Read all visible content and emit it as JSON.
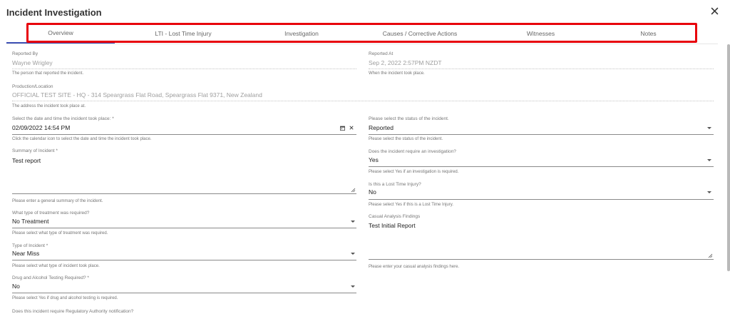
{
  "dialog": {
    "title": "Incident Investigation"
  },
  "tabs": [
    {
      "label": "Overview"
    },
    {
      "label": "LTI - Lost Time Injury"
    },
    {
      "label": "Investigation"
    },
    {
      "label": "Causes / Corrective Actions"
    },
    {
      "label": "Witnesses"
    },
    {
      "label": "Notes"
    }
  ],
  "form": {
    "reported_by": {
      "label": "Reported By",
      "value": "Wayne Wrigley",
      "hint": "The person that reported the incident."
    },
    "reported_at": {
      "label": "Reported At",
      "value": "Sep 2, 2022 2:57PM NZDT",
      "hint": "When the incident took place."
    },
    "production_location": {
      "label": "Production/Location",
      "value": "OFFICIAL TEST SITE - HQ - 314 Speargrass Flat Road, Speargrass Flat 9371, New Zealand",
      "hint": "The address the incident took place at."
    },
    "incident_datetime": {
      "label": "Select the date and time the incident took place: *",
      "value": "02/09/2022 14:54 PM",
      "hint": "Click the calendar icon to select the date and time the incident took place."
    },
    "status": {
      "label": "Please select the status of the incident.",
      "value": "Reported",
      "hint": "Please select the status of the incident."
    },
    "summary": {
      "label": "Summary of Incident *",
      "value": "Test report",
      "hint": "Please enter a general summary of the incident."
    },
    "requires_investigation": {
      "label": "Does the incident require an investigation?",
      "value": "Yes",
      "hint": "Please select Yes if an investigation is required."
    },
    "lost_time_injury": {
      "label": "Is this a Lost Time Injury?",
      "value": "No",
      "hint": "Please select Yes if this is a Lost Time Injury."
    },
    "treatment": {
      "label": "What type of treatment was required?",
      "value": "No Treatment",
      "hint": "Please select what type of treatment was required."
    },
    "casual_analysis": {
      "label": "Casual Analysis Findings",
      "value": "Test Initial Report",
      "hint": "Please enter your casual analysis findings here."
    },
    "incident_type": {
      "label": "Type of Incident *",
      "value": "Near Miss",
      "hint": "Please select what type of incident took place."
    },
    "drug_alcohol": {
      "label": "Drug and Alcohol Testing Required? *",
      "value": "No",
      "hint": "Please select Yes if drug and alcohol testing is required."
    },
    "regulatory": {
      "label": "Does this incident require Regulatory Authority notification?"
    }
  },
  "colors": {
    "accent": "#3f51b5",
    "highlight": "#e8000b"
  }
}
